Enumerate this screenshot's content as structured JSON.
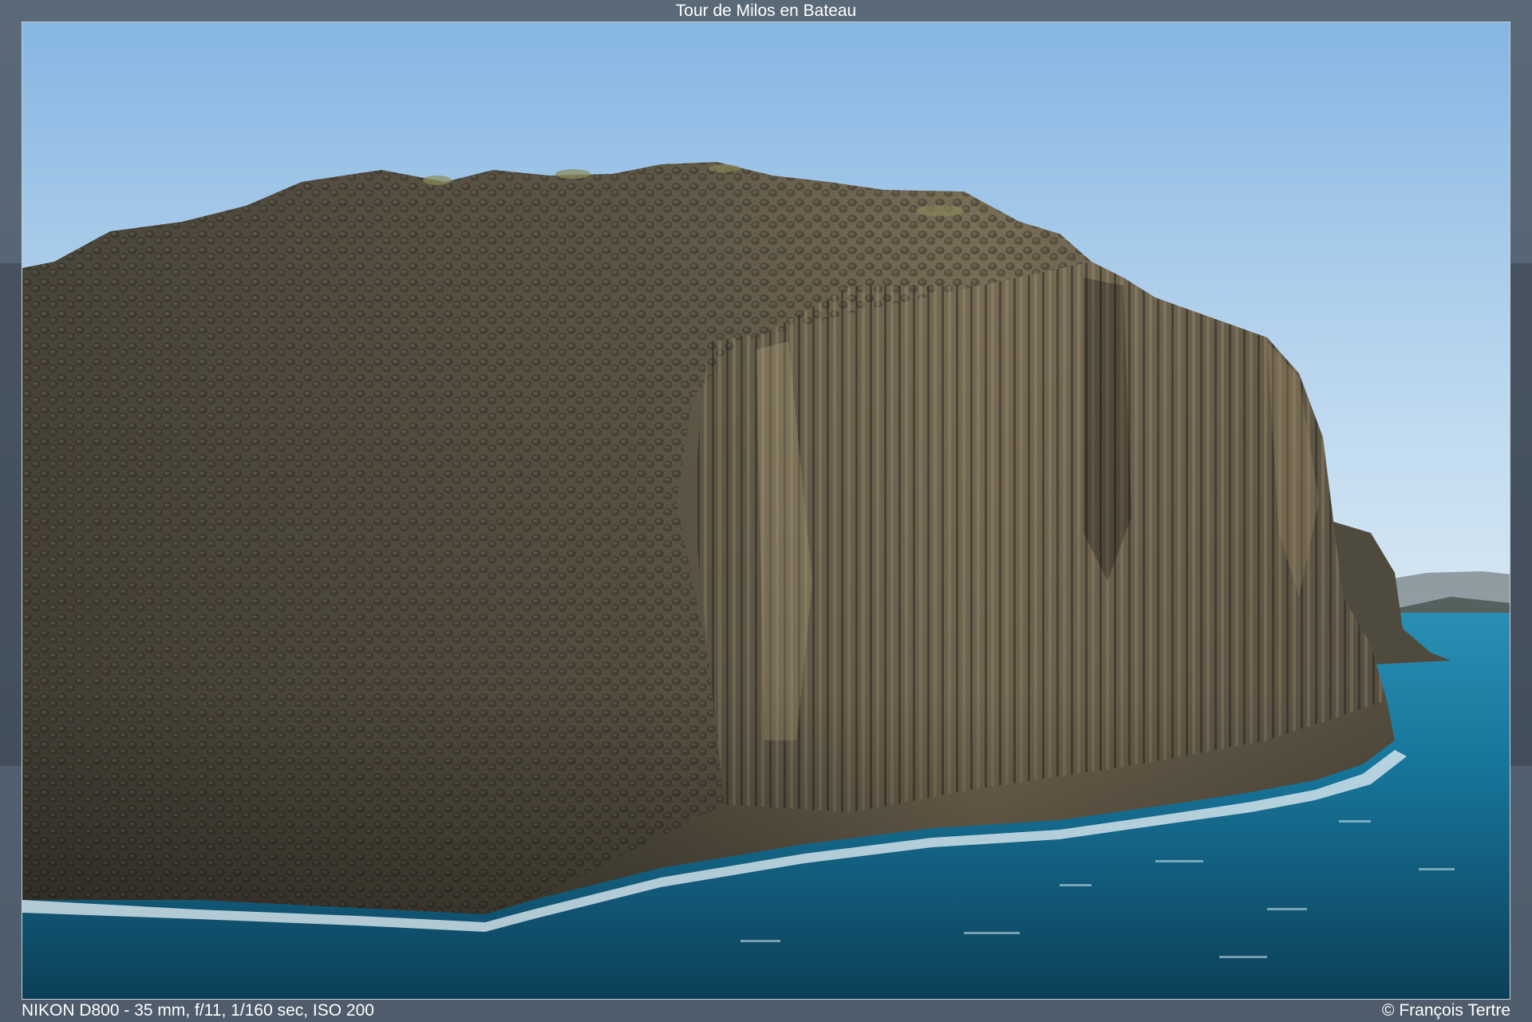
{
  "viewer": {
    "title": "Tour de Milos en Bateau",
    "exif": "NIKON D800 - 35 mm, f/11, 1/160 sec, ISO 200",
    "copyright": "© François Tertre"
  },
  "photo": {
    "subject": "basalt-column-cliff",
    "colors": {
      "sky_top": "#8fbde6",
      "sky_bottom": "#d6e8f4",
      "rock_dark": "#3d3a33",
      "rock_mid": "#6b6251",
      "rock_light": "#9c8f72",
      "sea_deep": "#0e4a64",
      "sea_mid": "#1a7da0",
      "foam": "#e8f2f6"
    }
  }
}
